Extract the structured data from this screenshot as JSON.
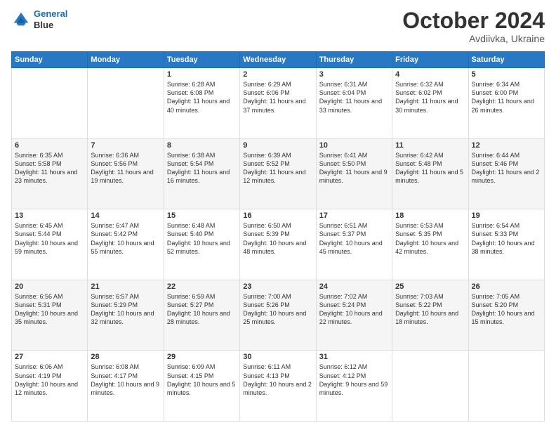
{
  "header": {
    "logo": {
      "line1": "General",
      "line2": "Blue"
    },
    "title": "October 2024",
    "location": "Avdiivka, Ukraine"
  },
  "weekdays": [
    "Sunday",
    "Monday",
    "Tuesday",
    "Wednesday",
    "Thursday",
    "Friday",
    "Saturday"
  ],
  "weeks": [
    [
      {
        "day": "",
        "sunrise": "",
        "sunset": "",
        "daylight": ""
      },
      {
        "day": "",
        "sunrise": "",
        "sunset": "",
        "daylight": ""
      },
      {
        "day": "1",
        "sunrise": "Sunrise: 6:28 AM",
        "sunset": "Sunset: 6:08 PM",
        "daylight": "Daylight: 11 hours and 40 minutes."
      },
      {
        "day": "2",
        "sunrise": "Sunrise: 6:29 AM",
        "sunset": "Sunset: 6:06 PM",
        "daylight": "Daylight: 11 hours and 37 minutes."
      },
      {
        "day": "3",
        "sunrise": "Sunrise: 6:31 AM",
        "sunset": "Sunset: 6:04 PM",
        "daylight": "Daylight: 11 hours and 33 minutes."
      },
      {
        "day": "4",
        "sunrise": "Sunrise: 6:32 AM",
        "sunset": "Sunset: 6:02 PM",
        "daylight": "Daylight: 11 hours and 30 minutes."
      },
      {
        "day": "5",
        "sunrise": "Sunrise: 6:34 AM",
        "sunset": "Sunset: 6:00 PM",
        "daylight": "Daylight: 11 hours and 26 minutes."
      }
    ],
    [
      {
        "day": "6",
        "sunrise": "Sunrise: 6:35 AM",
        "sunset": "Sunset: 5:58 PM",
        "daylight": "Daylight: 11 hours and 23 minutes."
      },
      {
        "day": "7",
        "sunrise": "Sunrise: 6:36 AM",
        "sunset": "Sunset: 5:56 PM",
        "daylight": "Daylight: 11 hours and 19 minutes."
      },
      {
        "day": "8",
        "sunrise": "Sunrise: 6:38 AM",
        "sunset": "Sunset: 5:54 PM",
        "daylight": "Daylight: 11 hours and 16 minutes."
      },
      {
        "day": "9",
        "sunrise": "Sunrise: 6:39 AM",
        "sunset": "Sunset: 5:52 PM",
        "daylight": "Daylight: 11 hours and 12 minutes."
      },
      {
        "day": "10",
        "sunrise": "Sunrise: 6:41 AM",
        "sunset": "Sunset: 5:50 PM",
        "daylight": "Daylight: 11 hours and 9 minutes."
      },
      {
        "day": "11",
        "sunrise": "Sunrise: 6:42 AM",
        "sunset": "Sunset: 5:48 PM",
        "daylight": "Daylight: 11 hours and 5 minutes."
      },
      {
        "day": "12",
        "sunrise": "Sunrise: 6:44 AM",
        "sunset": "Sunset: 5:46 PM",
        "daylight": "Daylight: 11 hours and 2 minutes."
      }
    ],
    [
      {
        "day": "13",
        "sunrise": "Sunrise: 6:45 AM",
        "sunset": "Sunset: 5:44 PM",
        "daylight": "Daylight: 10 hours and 59 minutes."
      },
      {
        "day": "14",
        "sunrise": "Sunrise: 6:47 AM",
        "sunset": "Sunset: 5:42 PM",
        "daylight": "Daylight: 10 hours and 55 minutes."
      },
      {
        "day": "15",
        "sunrise": "Sunrise: 6:48 AM",
        "sunset": "Sunset: 5:40 PM",
        "daylight": "Daylight: 10 hours and 52 minutes."
      },
      {
        "day": "16",
        "sunrise": "Sunrise: 6:50 AM",
        "sunset": "Sunset: 5:39 PM",
        "daylight": "Daylight: 10 hours and 48 minutes."
      },
      {
        "day": "17",
        "sunrise": "Sunrise: 6:51 AM",
        "sunset": "Sunset: 5:37 PM",
        "daylight": "Daylight: 10 hours and 45 minutes."
      },
      {
        "day": "18",
        "sunrise": "Sunrise: 6:53 AM",
        "sunset": "Sunset: 5:35 PM",
        "daylight": "Daylight: 10 hours and 42 minutes."
      },
      {
        "day": "19",
        "sunrise": "Sunrise: 6:54 AM",
        "sunset": "Sunset: 5:33 PM",
        "daylight": "Daylight: 10 hours and 38 minutes."
      }
    ],
    [
      {
        "day": "20",
        "sunrise": "Sunrise: 6:56 AM",
        "sunset": "Sunset: 5:31 PM",
        "daylight": "Daylight: 10 hours and 35 minutes."
      },
      {
        "day": "21",
        "sunrise": "Sunrise: 6:57 AM",
        "sunset": "Sunset: 5:29 PM",
        "daylight": "Daylight: 10 hours and 32 minutes."
      },
      {
        "day": "22",
        "sunrise": "Sunrise: 6:59 AM",
        "sunset": "Sunset: 5:27 PM",
        "daylight": "Daylight: 10 hours and 28 minutes."
      },
      {
        "day": "23",
        "sunrise": "Sunrise: 7:00 AM",
        "sunset": "Sunset: 5:26 PM",
        "daylight": "Daylight: 10 hours and 25 minutes."
      },
      {
        "day": "24",
        "sunrise": "Sunrise: 7:02 AM",
        "sunset": "Sunset: 5:24 PM",
        "daylight": "Daylight: 10 hours and 22 minutes."
      },
      {
        "day": "25",
        "sunrise": "Sunrise: 7:03 AM",
        "sunset": "Sunset: 5:22 PM",
        "daylight": "Daylight: 10 hours and 18 minutes."
      },
      {
        "day": "26",
        "sunrise": "Sunrise: 7:05 AM",
        "sunset": "Sunset: 5:20 PM",
        "daylight": "Daylight: 10 hours and 15 minutes."
      }
    ],
    [
      {
        "day": "27",
        "sunrise": "Sunrise: 6:06 AM",
        "sunset": "Sunset: 4:19 PM",
        "daylight": "Daylight: 10 hours and 12 minutes."
      },
      {
        "day": "28",
        "sunrise": "Sunrise: 6:08 AM",
        "sunset": "Sunset: 4:17 PM",
        "daylight": "Daylight: 10 hours and 9 minutes."
      },
      {
        "day": "29",
        "sunrise": "Sunrise: 6:09 AM",
        "sunset": "Sunset: 4:15 PM",
        "daylight": "Daylight: 10 hours and 5 minutes."
      },
      {
        "day": "30",
        "sunrise": "Sunrise: 6:11 AM",
        "sunset": "Sunset: 4:13 PM",
        "daylight": "Daylight: 10 hours and 2 minutes."
      },
      {
        "day": "31",
        "sunrise": "Sunrise: 6:12 AM",
        "sunset": "Sunset: 4:12 PM",
        "daylight": "Daylight: 9 hours and 59 minutes."
      },
      {
        "day": "",
        "sunrise": "",
        "sunset": "",
        "daylight": ""
      },
      {
        "day": "",
        "sunrise": "",
        "sunset": "",
        "daylight": ""
      }
    ]
  ]
}
